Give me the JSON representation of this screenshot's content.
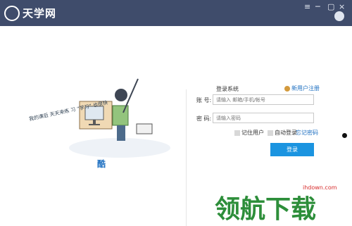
{
  "app": {
    "title": "天学网"
  },
  "window_controls": [
    {
      "name": "menu-icon",
      "glyph": "≡"
    },
    {
      "name": "minimize-icon",
      "glyph": "─"
    },
    {
      "name": "restore-icon",
      "glyph": "▢"
    },
    {
      "name": "close-icon",
      "glyph": "×"
    }
  ],
  "illustration": {
    "handwriting": "我的课后 天天来练 习 “学习” 也很快",
    "accent": "酷"
  },
  "login": {
    "section_title": "登录系统",
    "register_label": "新用户注册",
    "account_label": "账  号:",
    "account_placeholder": "请输入 邮箱/手机/帐号",
    "password_label": "密  码:",
    "password_placeholder": "请输入密码",
    "remember_label": "记住用户",
    "auto_login_label": "自动登录",
    "forgot_label": "忘记密码",
    "login_button": "登录"
  },
  "watermark": {
    "site": "ihdown.com",
    "text": "领航下载"
  }
}
